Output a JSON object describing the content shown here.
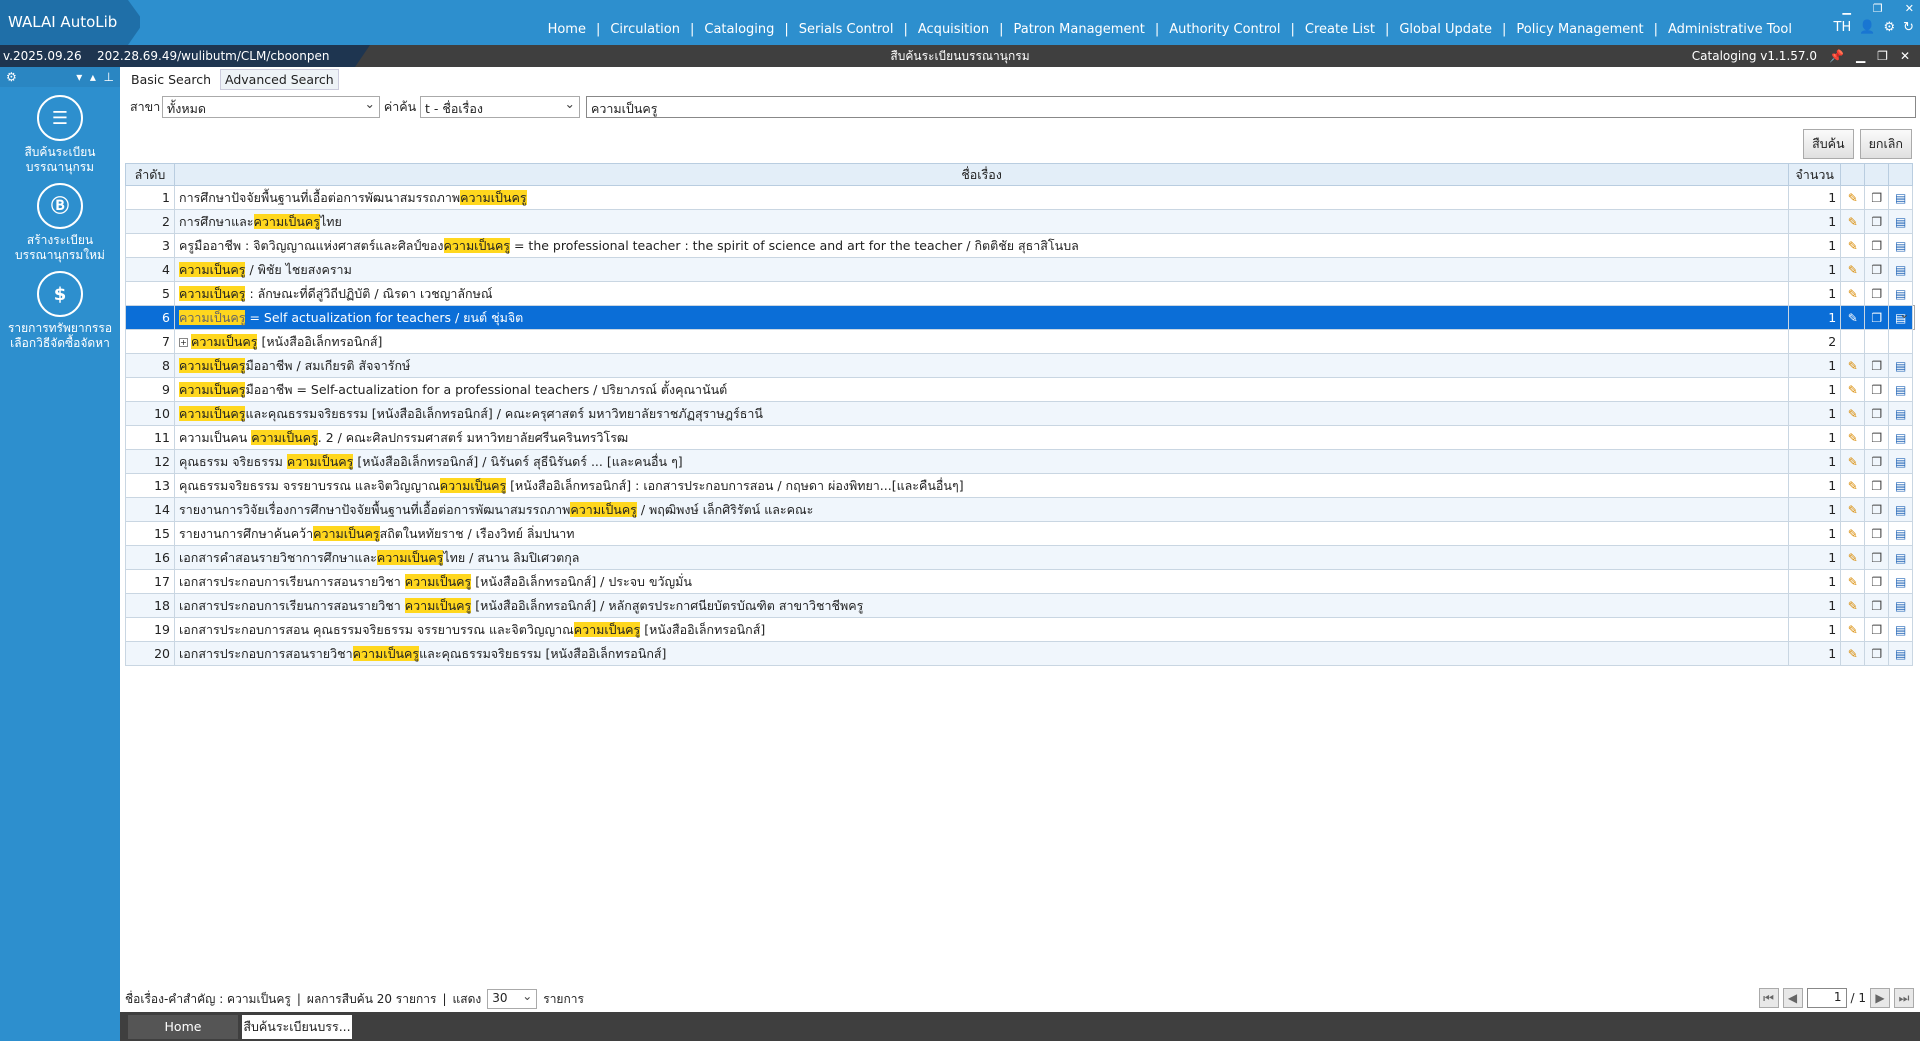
{
  "app": {
    "title": "WALAI AutoLib",
    "version": "v.2025.09.26",
    "host": "202.28.69.49/wulibutm/CLM/cboonpen",
    "center_title": "สืบค้นระเบียนบรรณานุกรม",
    "module_version": "Cataloging v1.1.57.0",
    "lang": "TH"
  },
  "topnav": [
    "Home",
    "Circulation",
    "Cataloging",
    "Serials Control",
    "Acquisition",
    "Patron Management",
    "Authority Control",
    "Create List",
    "Global Update",
    "Policy Management",
    "Administrative Tool"
  ],
  "sidebar": [
    {
      "label": "สืบค้นระเบียน บรรณานุกรม",
      "icon": "search-record-icon"
    },
    {
      "label": "สร้างระเบียน บรรณานุกรมใหม่",
      "icon": "new-record-icon"
    },
    {
      "label": "รายการทรัพยากรรอ เลือกวิธีจัดซื้อจัดหา",
      "icon": "acquisition-list-icon"
    }
  ],
  "tabs": {
    "basic": "Basic Search",
    "advanced": "Advanced Search"
  },
  "search": {
    "branch_label": "สาขา",
    "branch_value": "ทั้งหมด",
    "key_label": "ค่าค้น",
    "key_value": "t - ชื่อเรื่อง",
    "query": "ความเป็นครู",
    "submit": "สืบค้น",
    "cancel": "ยกเลิก"
  },
  "grid": {
    "col_no": "ลำดับ",
    "col_title": "ชื่อเรื่อง",
    "col_count": "จำนวน"
  },
  "rows": [
    {
      "n": "1",
      "pre": "การศึกษาปัจจัยพื้นฐานที่เอื้อต่อการพัฒนาสมรรถภาพ",
      "hl": "ความเป็นครู",
      "post": "",
      "c": "1"
    },
    {
      "n": "2",
      "pre": "การศึกษาและ",
      "hl": "ความเป็นครู",
      "post": "ไทย",
      "c": "1"
    },
    {
      "n": "3",
      "pre": "ครูมืออาชีพ : จิตวิญญาณแห่งศาสตร์และศิลป์ของ",
      "hl": "ความเป็นครู",
      "post": " = the professional teacher : the spirit of science and art for the teacher / กิตติชัย สุธาสิโนบล",
      "c": "1"
    },
    {
      "n": "4",
      "pre": "",
      "hl": "ความเป็นครู",
      "post": " / พิชัย ไชยสงคราม",
      "c": "1"
    },
    {
      "n": "5",
      "pre": "",
      "hl": "ความเป็นครู",
      "post": " : ลักษณะที่ดีสู่วิถีปฏิบัติ / ณิรดา เวชญาลักษณ์",
      "c": "1"
    },
    {
      "n": "6",
      "pre": "",
      "hl": "ความเป็นครู",
      "post": " = Self actualization for teachers / ยนต์ ชุ่มจิต",
      "c": "1"
    },
    {
      "n": "7",
      "pre": "",
      "hl": "ความเป็นครู",
      "post": " [หนังสืออิเล็กทรอนิกส์]",
      "c": "2"
    },
    {
      "n": "8",
      "pre": "",
      "hl": "ความเป็นครู",
      "post": "มืออาชีพ / สมเกียรติ สัจจารักษ์",
      "c": "1"
    },
    {
      "n": "9",
      "pre": "",
      "hl": "ความเป็นครู",
      "post": "มืออาชีพ = Self-actualization for a professional teachers / ปริยาภรณ์ ตั้งคุณานันต์",
      "c": "1"
    },
    {
      "n": "10",
      "pre": "",
      "hl": "ความเป็นครู",
      "post": "และคุณธรรมจริยธรรม [หนังสืออิเล็กทรอนิกส์] / คณะครุศาสตร์ มหาวิทยาลัยราชภัฏสุราษฎร์ธานี",
      "c": "1"
    },
    {
      "n": "11",
      "pre": "ความเป็นคน ",
      "hl": "ความเป็นครู",
      "post": ". 2 / คณะศิลปกรรมศาสตร์ มหาวิทยาลัยศรีนครินทรวิโรฒ",
      "c": "1"
    },
    {
      "n": "12",
      "pre": "คุณธรรม จริยธรรม ",
      "hl": "ความเป็นครู",
      "post": " [หนังสืออิเล็กทรอนิกส์] / นิรันดร์ สุธีนิรันดร์ ... [และคนอื่น ๆ]",
      "c": "1"
    },
    {
      "n": "13",
      "pre": "คุณธรรมจริยธรรม จรรยาบรรณ และจิตวิญญาณ",
      "hl": "ความเป็นครู",
      "post": " [หนังสืออิเล็กทรอนิกส์] : เอกสารประกอบการสอน / กฤษดา ผ่องพิทยา...[และคืนอื่นๆ]",
      "c": "1"
    },
    {
      "n": "14",
      "pre": "รายงานการวิจัยเรื่องการศึกษาปัจจัยพื้นฐานที่เอื้อต่อการพัฒนาสมรรถภาพ",
      "hl": "ความเป็นครู",
      "post": " / พฤฒิพงษ์ เล็กศิริรัตน์ และคณะ",
      "c": "1"
    },
    {
      "n": "15",
      "pre": "รายงานการศึกษาค้นคว้า",
      "hl": "ความเป็นครู",
      "post": "สถิตในหทัยราช / เรืองวิทย์ ลิ่มปนาท",
      "c": "1"
    },
    {
      "n": "16",
      "pre": "เอกสารคำสอนรายวิชาการศึกษาและ",
      "hl": "ความเป็นครู",
      "post": "ไทย / สนาน ลิมปิเศวตกุล",
      "c": "1"
    },
    {
      "n": "17",
      "pre": "เอกสารประกอบการเรียนการสอนรายวิชา ",
      "hl": "ความเป็นครู",
      "post": " [หนังสืออิเล็กทรอนิกส์] / ประจบ ขวัญมั่น",
      "c": "1"
    },
    {
      "n": "18",
      "pre": "เอกสารประกอบการเรียนการสอนรายวิชา ",
      "hl": "ความเป็นครู",
      "post": " [หนังสืออิเล็กทรอนิกส์] / หลักสูตรประกาศนียบัตรบัณฑิต สาขาวิชาชีพครู",
      "c": "1"
    },
    {
      "n": "19",
      "pre": "เอกสารประกอบการสอน คุณธรรมจริยธรรม จรรยาบรรณ และจิตวิญญาณ",
      "hl": "ความเป็นครู",
      "post": " [หนังสืออิเล็กทรอนิกส์]",
      "c": "1"
    },
    {
      "n": "20",
      "pre": "เอกสารประกอบการสอนรายวิชา",
      "hl": "ความเป็นครู",
      "post": "และคุณธรรมจริยธรรม [หนังสืออิเล็กทรอนิกส์]",
      "c": "1"
    }
  ],
  "status": {
    "keyword": "ชื่อเรื่อง-คำสำคัญ : ความเป็นครู",
    "results": "ผลการสืบค้น 20 รายการ",
    "show_label": "แสดง",
    "show_value": "30",
    "items_label": "รายการ",
    "page": "1",
    "total": "/ 1"
  },
  "bottomtabs": [
    "Home",
    "สืบค้นระเบียนบรร..."
  ]
}
